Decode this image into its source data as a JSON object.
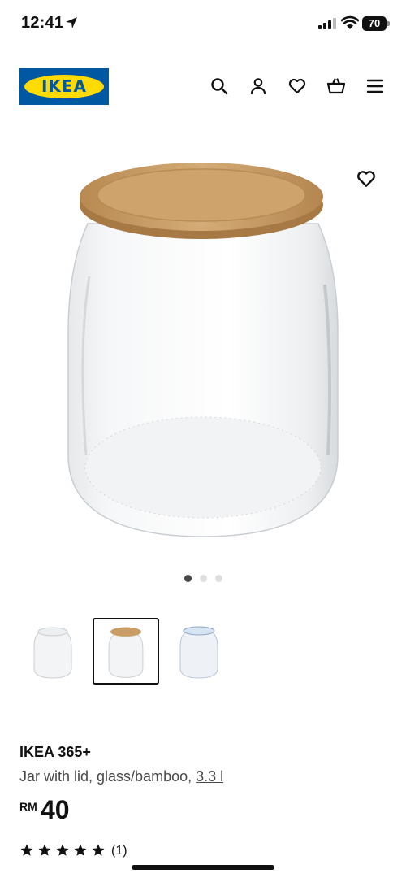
{
  "status_bar": {
    "time": "12:41",
    "battery": "70"
  },
  "header": {
    "logo_text": "IKEA"
  },
  "gallery": {
    "slides_total": 3,
    "active_slide": 1
  },
  "product": {
    "name": "IKEA 365+",
    "description": "Jar with lid, glass/bamboo, ",
    "volume": "3.3 l",
    "currency": "RM",
    "price": "40",
    "rating_value": 5,
    "rating_count": "(1)"
  },
  "colors": {
    "ikea_blue": "#0058a3",
    "ikea_yellow": "#ffdb00",
    "bamboo": "#c9a06a"
  }
}
